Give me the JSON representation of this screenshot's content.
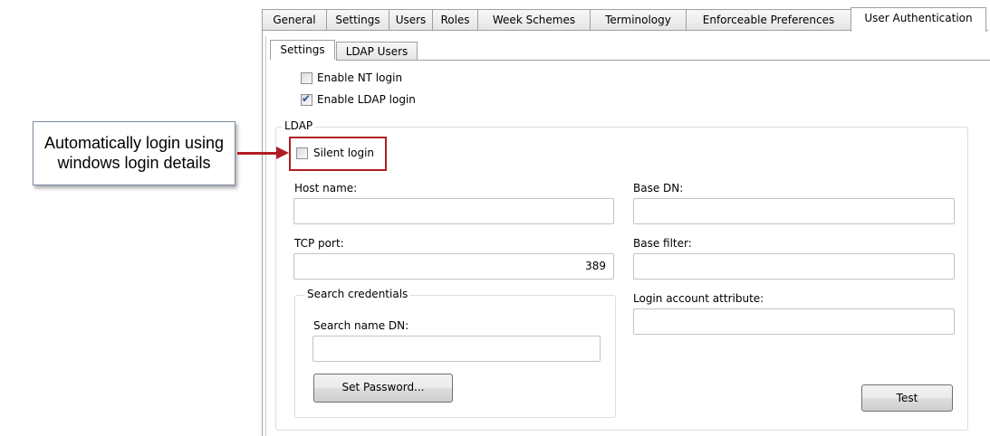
{
  "main_tabs": [
    {
      "label": "General",
      "active": false
    },
    {
      "label": "Settings",
      "active": false
    },
    {
      "label": "Users",
      "active": false
    },
    {
      "label": "Roles",
      "active": false
    },
    {
      "label": "Week Schemes",
      "active": false
    },
    {
      "label": "Terminology",
      "active": false
    },
    {
      "label": "Enforceable Preferences",
      "active": false
    },
    {
      "label": "User Authentication",
      "active": true
    }
  ],
  "sub_tabs": [
    {
      "label": "Settings",
      "active": true
    },
    {
      "label": "LDAP Users",
      "active": false
    }
  ],
  "options": {
    "enable_nt_login": {
      "label": "Enable NT login",
      "checked": false
    },
    "enable_ldap_login": {
      "label": "Enable LDAP login",
      "checked": true
    }
  },
  "ldap": {
    "group_label": "LDAP",
    "silent_login": {
      "label": "Silent login",
      "checked": false
    },
    "host_name": {
      "label": "Host name:",
      "value": ""
    },
    "tcp_port": {
      "label": "TCP port:",
      "value": "389"
    },
    "search_credentials": {
      "group_label": "Search credentials",
      "search_name_dn": {
        "label": "Search name DN:",
        "value": ""
      },
      "set_password_label": "Set Password..."
    },
    "base_dn": {
      "label": "Base DN:",
      "value": ""
    },
    "base_filter": {
      "label": "Base filter:",
      "value": ""
    },
    "login_account_attribute": {
      "label": "Login account attribute:",
      "value": ""
    },
    "test_label": "Test"
  },
  "annotation": {
    "callout_line1": "Automatically login using",
    "callout_line2": "windows login details",
    "highlight_color": "#b01e24"
  }
}
